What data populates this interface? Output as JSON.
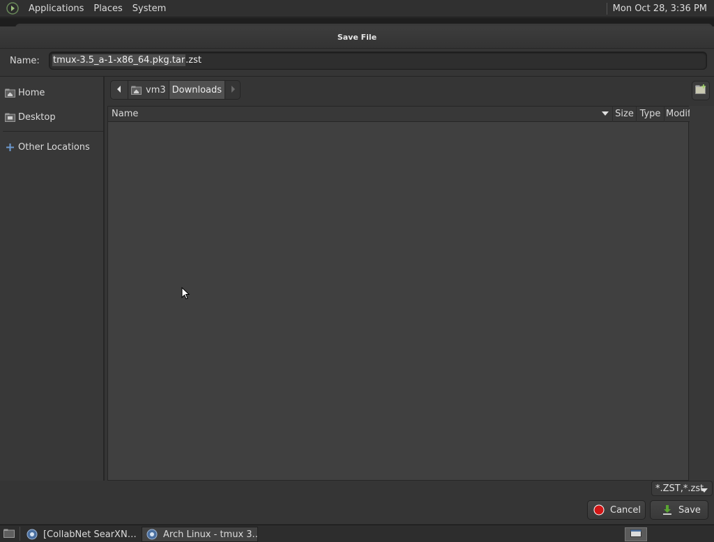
{
  "top_panel": {
    "menus": [
      "Applications",
      "Places",
      "System"
    ],
    "clock": "Mon Oct 28,  3:36 PM"
  },
  "dialog": {
    "title": "Save File",
    "name_label": "Name:",
    "filename_selected": "tmux-3.5_a-1-x86_64.pkg.tar",
    "filename_rest": ".zst"
  },
  "sidebar": {
    "items": [
      {
        "label": "Home",
        "icon": "home-folder-icon"
      },
      {
        "label": "Desktop",
        "icon": "desktop-folder-icon"
      },
      {
        "label": "Other Locations",
        "icon": "plus-icon"
      }
    ]
  },
  "pathbar": {
    "segments": [
      "vm3",
      "Downloads"
    ]
  },
  "filelist": {
    "columns": [
      "Name",
      "Size",
      "Type",
      "Modified"
    ]
  },
  "filter": {
    "selected": "*.ZST,*.zst"
  },
  "buttons": {
    "cancel": "Cancel",
    "save": "Save"
  },
  "taskbar": {
    "tasks": [
      "[CollabNet SearXN…",
      "Arch Linux - tmux 3.…"
    ]
  },
  "colors": {
    "panel": "#303030",
    "dialog": "#353535",
    "list_bg": "#404040",
    "cancel_red": "#d01616",
    "save_green": "#5aa632",
    "folder_accent": "#8ab4d8"
  }
}
